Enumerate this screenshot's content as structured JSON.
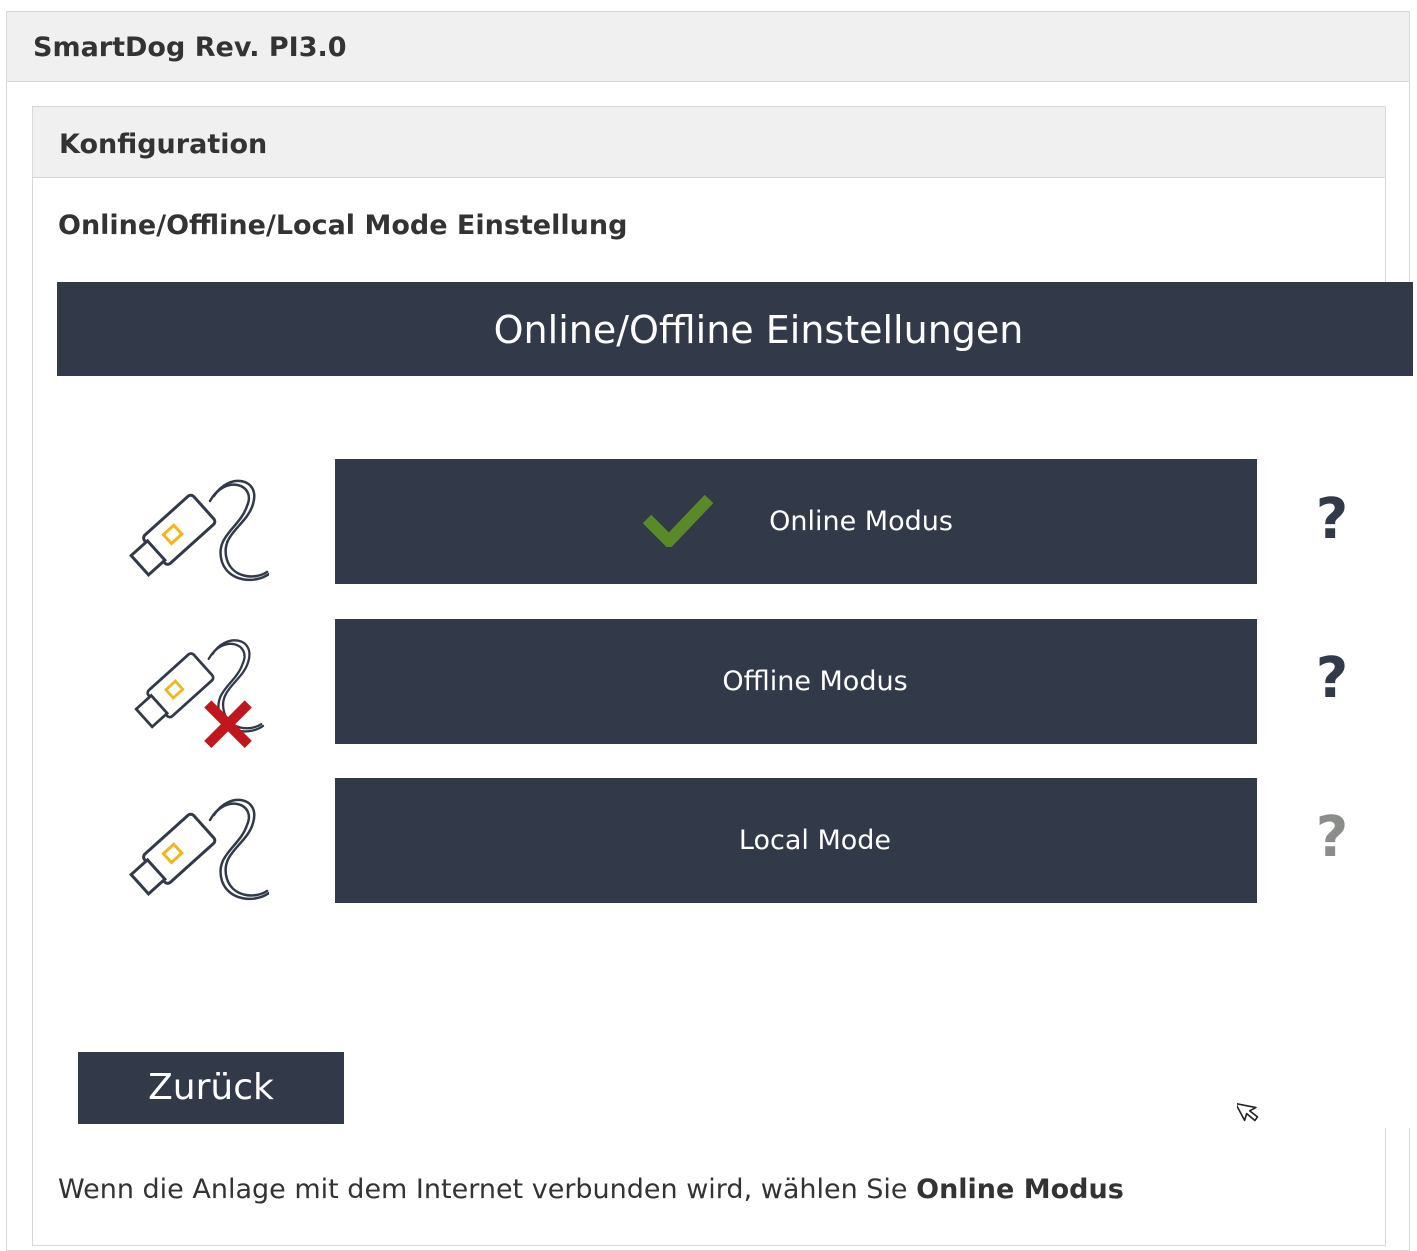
{
  "outer_panel": {
    "title": "SmartDog Rev. PI3.0"
  },
  "inner_panel": {
    "title": "Konfiguration"
  },
  "section": {
    "title": "Online/Offline/Local Mode Einstellung"
  },
  "screenshot": {
    "banner_title": "Online/Offline Einstellungen",
    "modes": [
      {
        "label": "Online Modus",
        "selected": true,
        "icon": "ethernet-cable-icon",
        "help": "?",
        "help_color": "#323a4a"
      },
      {
        "label": "Offline Modus",
        "selected": false,
        "icon": "ethernet-cable-disconnected-icon",
        "help": "?",
        "help_color": "#323a4a"
      },
      {
        "label": "Local Mode",
        "selected": false,
        "icon": "ethernet-cable-icon",
        "help": "?",
        "help_color": "#8a8d8a"
      }
    ],
    "back_label": "Zurück",
    "colors": {
      "button": "#323a4a",
      "check": "#5a8a28",
      "cross": "#c0171d",
      "plug_accent": "#f2b51d"
    }
  },
  "paragraph": {
    "text_before": "Wenn die Anlage mit dem Internet verbunden wird, wählen Sie ",
    "bold": "Online Modus"
  }
}
